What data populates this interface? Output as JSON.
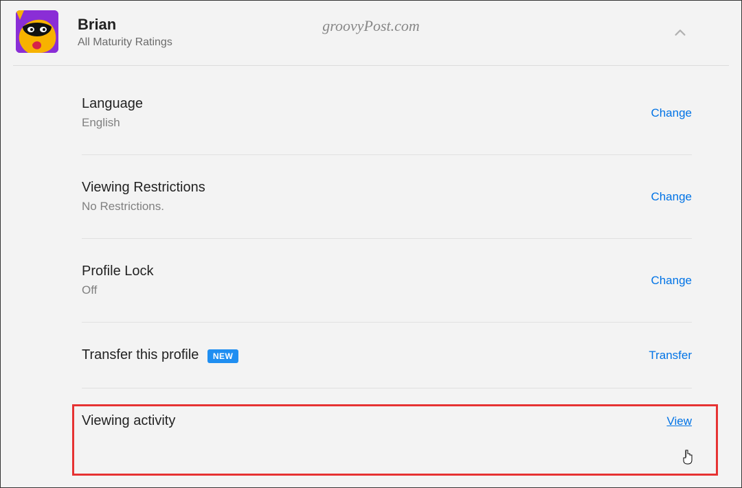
{
  "watermark": "groovyPost.com",
  "profile": {
    "name": "Brian",
    "subtitle": "All Maturity Ratings"
  },
  "rows": {
    "language": {
      "title": "Language",
      "value": "English",
      "action": "Change"
    },
    "restrictions": {
      "title": "Viewing Restrictions",
      "value": "No Restrictions.",
      "action": "Change"
    },
    "lock": {
      "title": "Profile Lock",
      "value": "Off",
      "action": "Change"
    },
    "transfer": {
      "title": "Transfer this profile",
      "badge": "NEW",
      "action": "Transfer"
    },
    "activity": {
      "title": "Viewing activity",
      "action": "View"
    }
  }
}
